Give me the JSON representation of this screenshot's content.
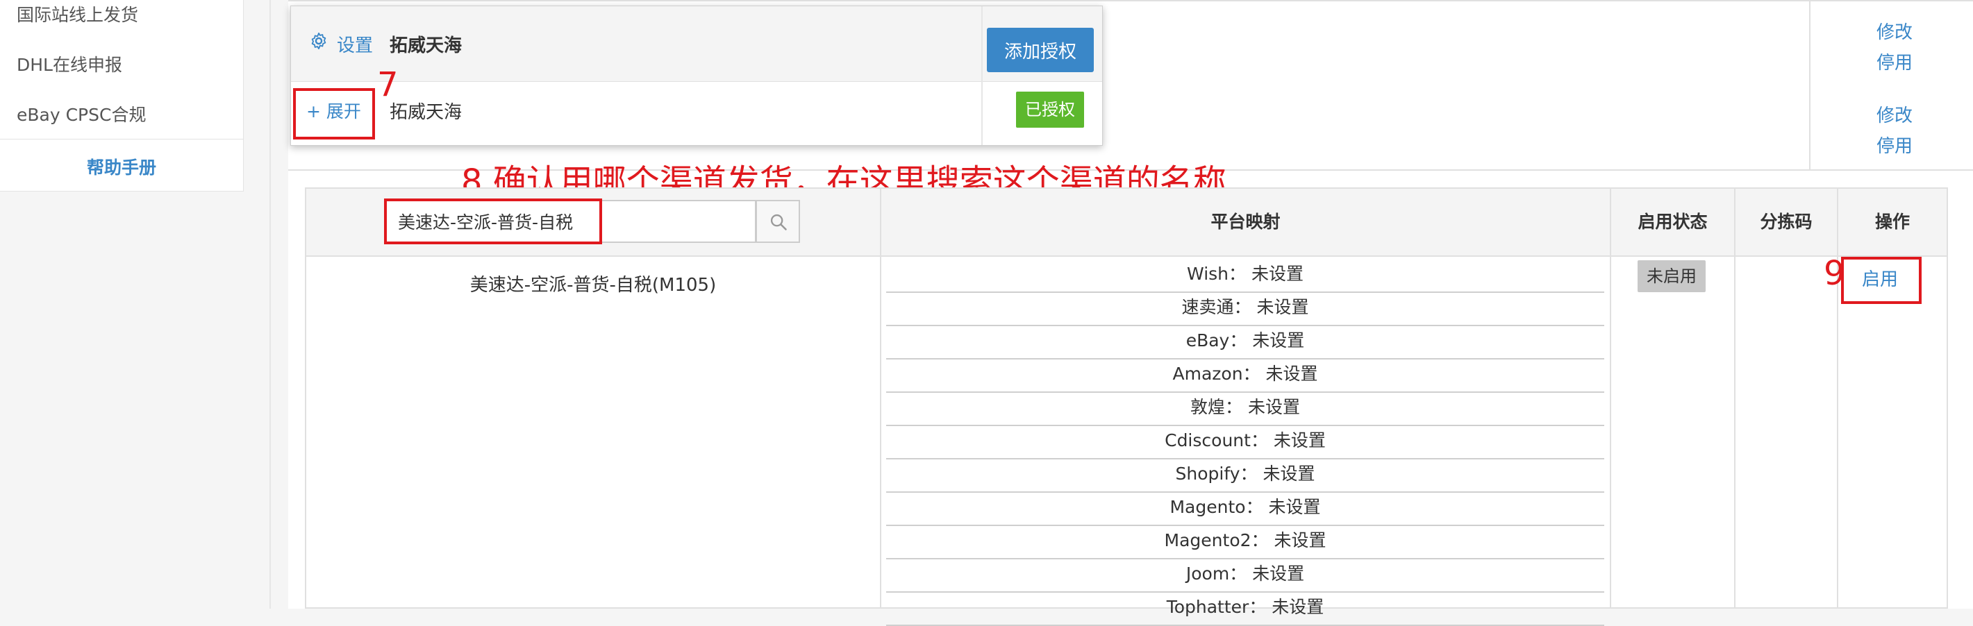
{
  "sidebar": {
    "items": [
      "国际站线上发货",
      "DHL在线申报",
      "eBay CPSC合规"
    ],
    "help": "帮助手册"
  },
  "bg_rows": [
    {
      "edit": "修改",
      "disable": "停用"
    },
    {
      "edit": "修改",
      "disable": "停用"
    }
  ],
  "popup": {
    "settings_label": "设置",
    "account_name": "拓威天海",
    "add_auth_button": "添加授权",
    "expand_label": "+ 展开",
    "row_name": "拓威天海",
    "auth_status": "已授权"
  },
  "annotations": {
    "step7": "7",
    "step8": "8.确认用哪个渠道发货，在这里搜索这个渠道的名称",
    "step9": "9"
  },
  "search": {
    "value": "美速达-空派-普货-自税"
  },
  "table": {
    "headers": {
      "platform_mapping": "平台映射",
      "status": "启用状态",
      "sort_code": "分拣码",
      "action": "操作"
    },
    "row": {
      "channel_name": "美速达-空派-普货-自税(M105)",
      "status": "未启用",
      "action": "启用",
      "mappings": [
        "Wish： 未设置",
        "速卖通： 未设置",
        "eBay： 未设置",
        "Amazon： 未设置",
        "敦煌： 未设置",
        "Cdiscount： 未设置",
        "Shopify： 未设置",
        "Magento： 未设置",
        "Magento2： 未设置",
        "Joom： 未设置",
        "Tophatter： 未设置"
      ]
    }
  },
  "colors": {
    "link": "#3a87c8",
    "annotation_red": "#e0191e",
    "authorized_green": "#5cb82d",
    "disabled_grey": "#c8c8c8"
  }
}
